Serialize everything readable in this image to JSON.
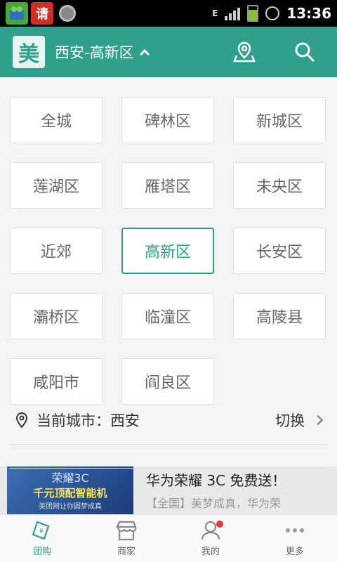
{
  "status_bar": {
    "app_icon_red_glyph": "请",
    "network_labels": [
      "E",
      "E"
    ],
    "time": "13:36"
  },
  "header": {
    "logo_text": "美",
    "city": "西安-高新区"
  },
  "districts": [
    {
      "label": "全城",
      "selected": false
    },
    {
      "label": "碑林区",
      "selected": false
    },
    {
      "label": "新城区",
      "selected": false
    },
    {
      "label": "莲湖区",
      "selected": false
    },
    {
      "label": "雁塔区",
      "selected": false
    },
    {
      "label": "未央区",
      "selected": false
    },
    {
      "label": "近郊",
      "selected": false
    },
    {
      "label": "高新区",
      "selected": true
    },
    {
      "label": "长安区",
      "selected": false
    },
    {
      "label": "灞桥区",
      "selected": false
    },
    {
      "label": "临潼区",
      "selected": false
    },
    {
      "label": "高陵县",
      "selected": false
    },
    {
      "label": "咸阳市",
      "selected": false
    },
    {
      "label": "阎良区",
      "selected": false
    }
  ],
  "current_city": {
    "label": "当前城市：西安",
    "switch_label": "切换"
  },
  "banner": {
    "brand": "荣耀3C",
    "promo": "千元顶配智能机",
    "sub": "美团网让你圆梦成真",
    "title": "华为荣耀 3C 免费送！",
    "desc": "【全国】美梦成真，华为荣"
  },
  "bottom_nav": [
    {
      "label": "团购",
      "icon": "coupon-icon",
      "active": true
    },
    {
      "label": "商家",
      "icon": "store-icon",
      "active": false
    },
    {
      "label": "我的",
      "icon": "user-icon",
      "active": false
    },
    {
      "label": "更多",
      "icon": "more-icon",
      "active": false
    }
  ],
  "colors": {
    "accent": "#2fa08c",
    "badge": "#e53935"
  }
}
